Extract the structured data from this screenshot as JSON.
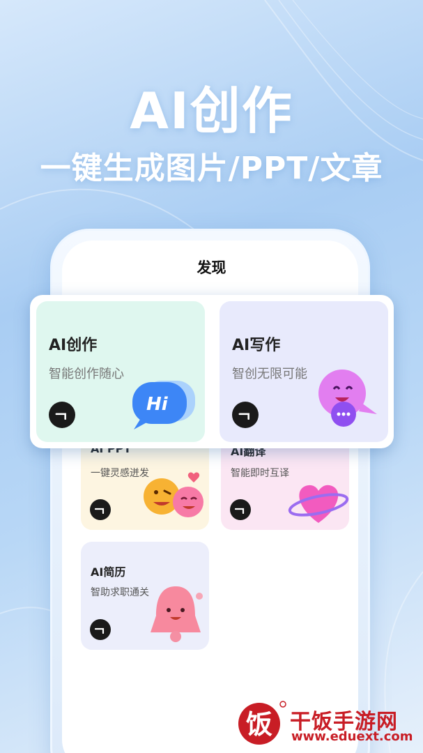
{
  "hero": {
    "title": "AI创作",
    "subtitle": "一键生成图片/PPT/文章"
  },
  "screen": {
    "title": "发现"
  },
  "featured_cards": [
    {
      "title": "AI创作",
      "subtitle": "智能创作随心",
      "icon": "hi-chat-bubble-icon",
      "color": "#dff7ef"
    },
    {
      "title": "AI写作",
      "subtitle": "智创无限可能",
      "icon": "purple-bubble-mascot-icon",
      "color": "#e8eafc"
    }
  ],
  "cards": [
    {
      "title": "AI PPT",
      "subtitle": "一键灵感迸发",
      "icon": "emoji-faces-icon",
      "color": "#fdf5e1"
    },
    {
      "title": "AI翻译",
      "subtitle": "智能即时互译",
      "icon": "heart-planet-icon",
      "color": "#fbe6f3"
    },
    {
      "title": "AI简历",
      "subtitle": "智助求职通关",
      "icon": "pink-bell-mascot-icon",
      "color": "#eceefb"
    }
  ],
  "watermark": {
    "name": "干饭手游网",
    "url": "www.eduext.com",
    "logo_char": "饭"
  }
}
